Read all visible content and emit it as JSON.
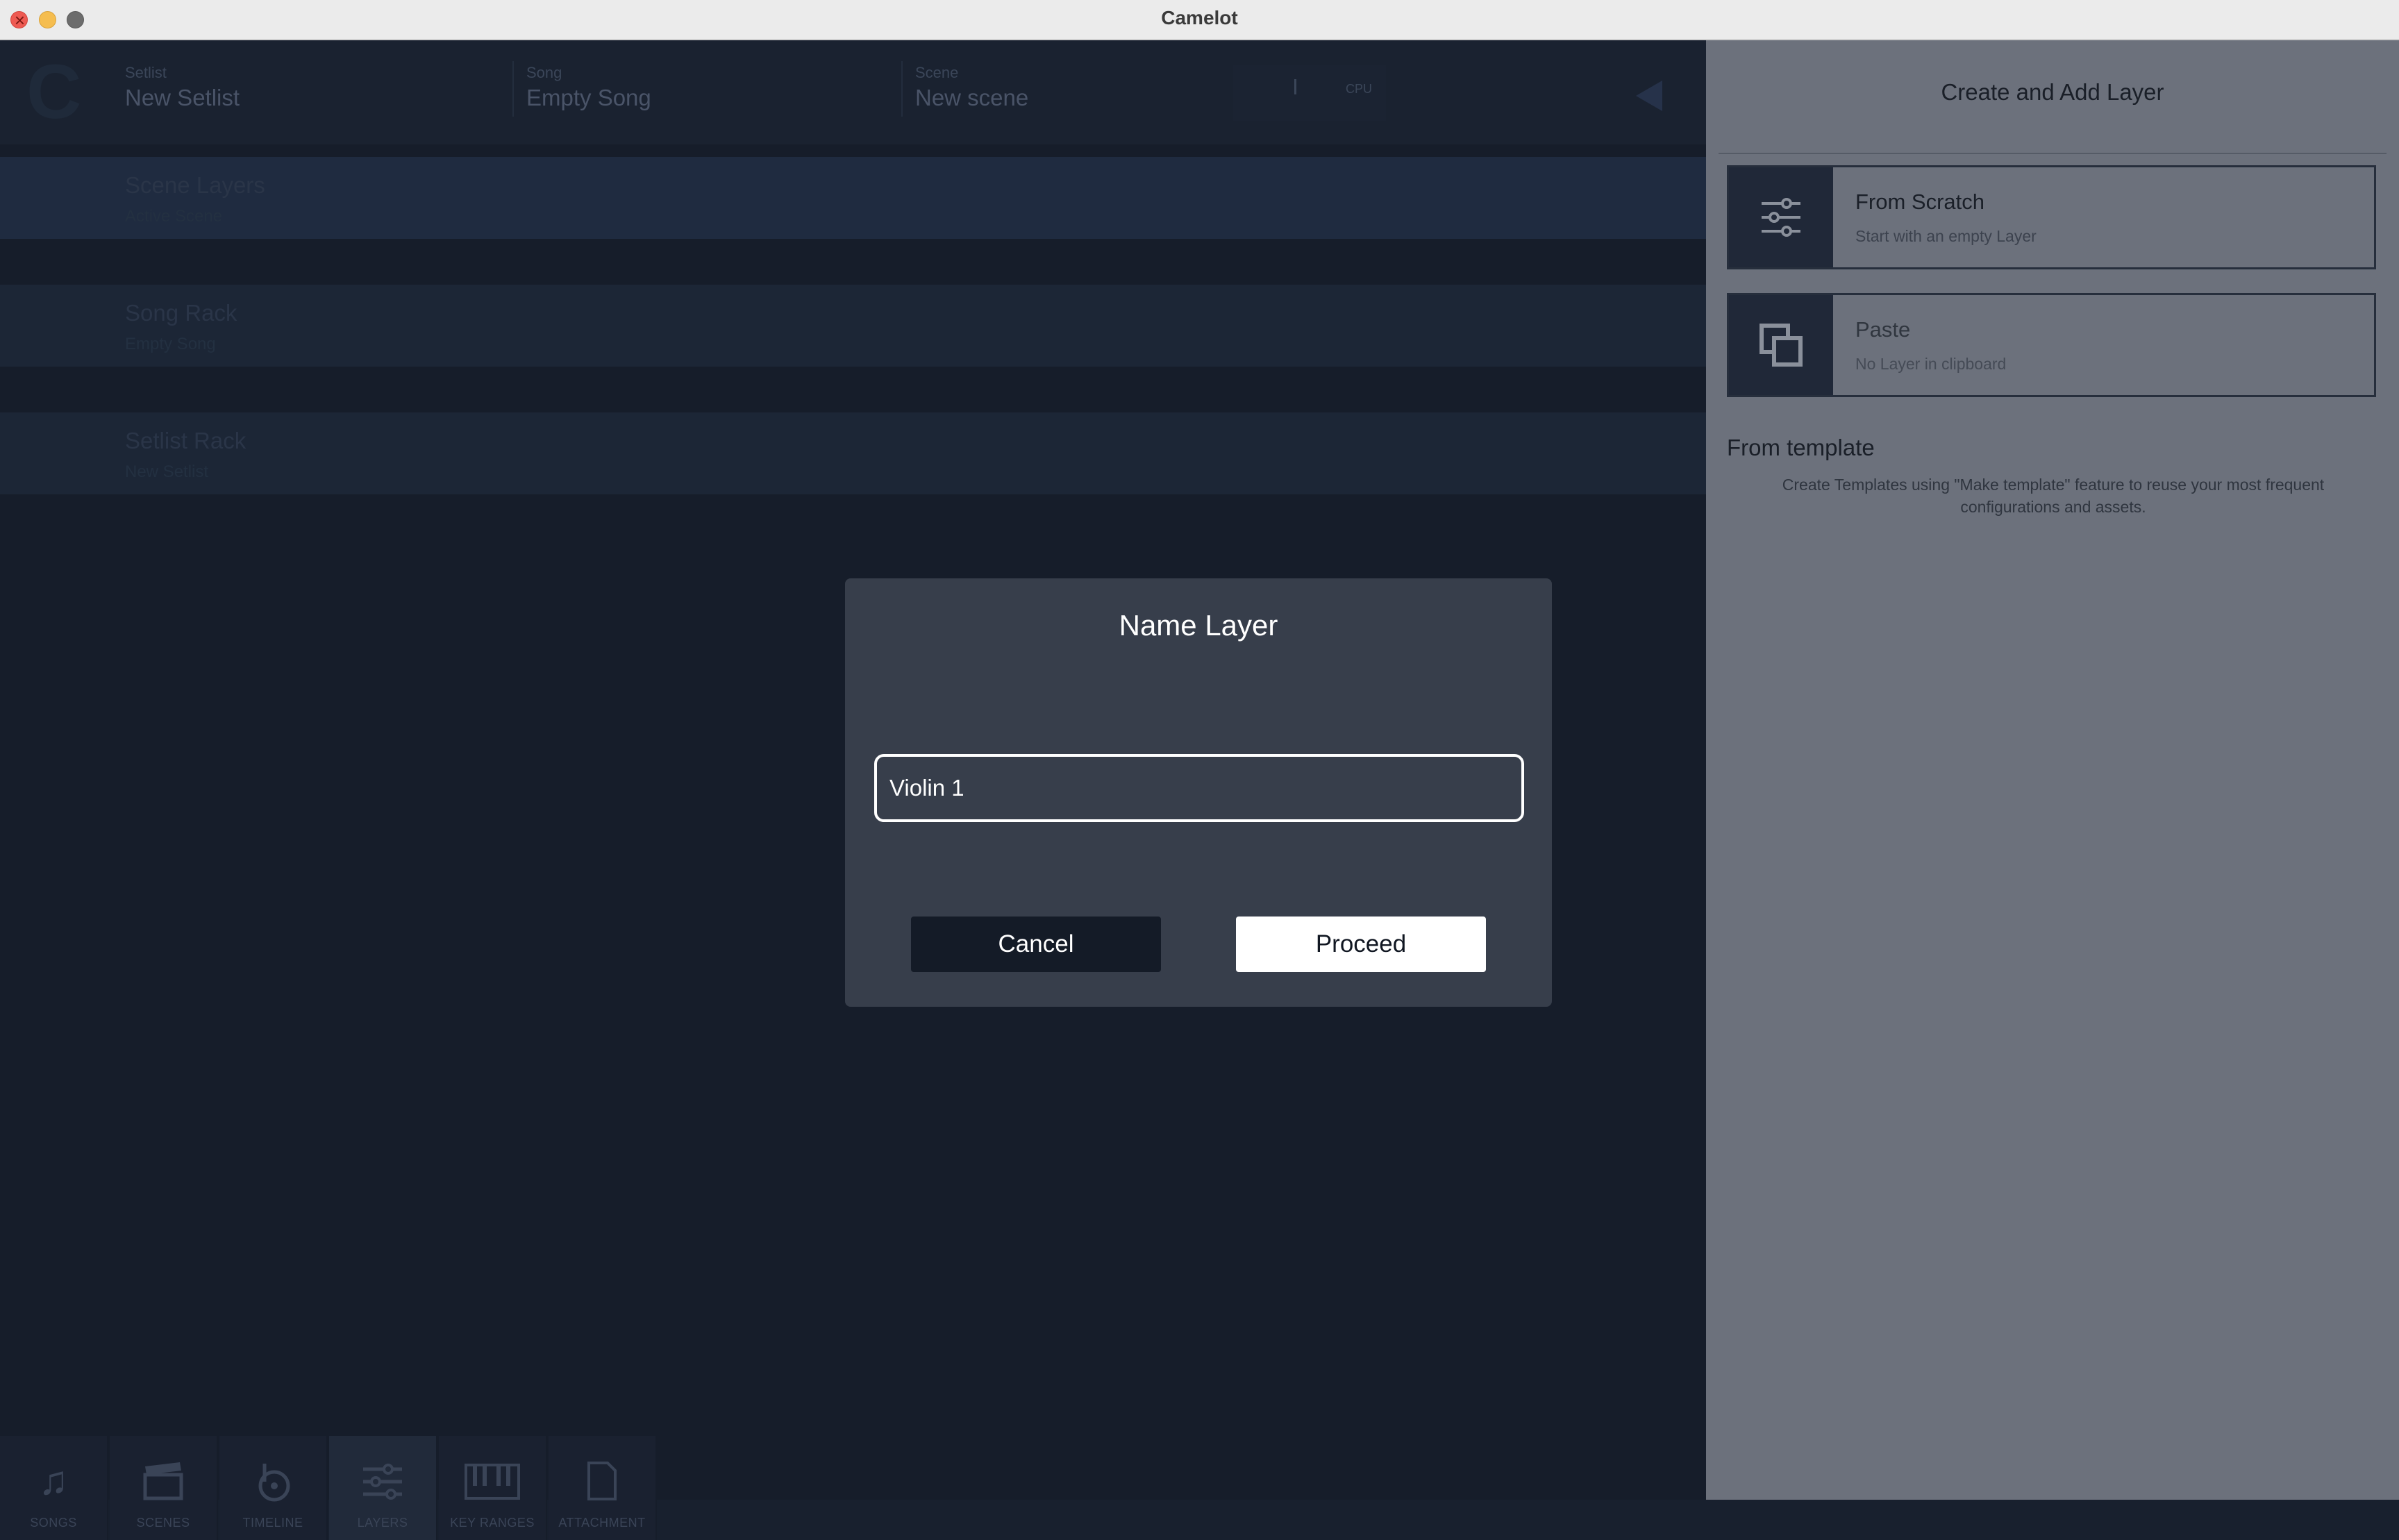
{
  "window": {
    "title": "Camelot"
  },
  "header": {
    "setlist_label": "Setlist",
    "setlist_value": "New Setlist",
    "song_label": "Song",
    "song_value": "Empty Song",
    "scene_label": "Scene",
    "scene_value": "New scene",
    "cpu_label": "CPU"
  },
  "layers": [
    {
      "title": "Scene Layers",
      "subtitle": "Active Scene"
    },
    {
      "title": "Song Rack",
      "subtitle": "Empty Song"
    },
    {
      "title": "Setlist Rack",
      "subtitle": "New Setlist"
    }
  ],
  "bottom_tabs": [
    {
      "label": "SONGS",
      "icon": "music-note-icon"
    },
    {
      "label": "SCENES",
      "icon": "clapperboard-icon"
    },
    {
      "label": "TIMELINE",
      "icon": "timeline-icon"
    },
    {
      "label": "LAYERS",
      "icon": "sliders-icon",
      "active": true
    },
    {
      "label": "KEY RANGES",
      "icon": "piano-keys-icon"
    },
    {
      "label": "ATTACHMENT",
      "icon": "document-icon"
    }
  ],
  "panel": {
    "title": "Create and Add Layer",
    "options": [
      {
        "title": "From Scratch",
        "subtitle": "Start with an empty Layer",
        "icon": "sliders-icon"
      },
      {
        "title": "Paste",
        "subtitle": "No Layer in clipboard",
        "icon": "paste-icon"
      }
    ],
    "template_heading": "From template",
    "template_desc": "Create Templates using \"Make template\" feature to reuse your most frequent configurations and assets."
  },
  "modal": {
    "title": "Name Layer",
    "input_value": "Violin 1",
    "cancel_label": "Cancel",
    "proceed_label": "Proceed"
  },
  "colors": {
    "modal_bg": "#373e4b",
    "panel_bg": "#6c717c",
    "main_bg": "#161d2a",
    "primary_button": "#ffffff",
    "secondary_button": "#141b27"
  }
}
